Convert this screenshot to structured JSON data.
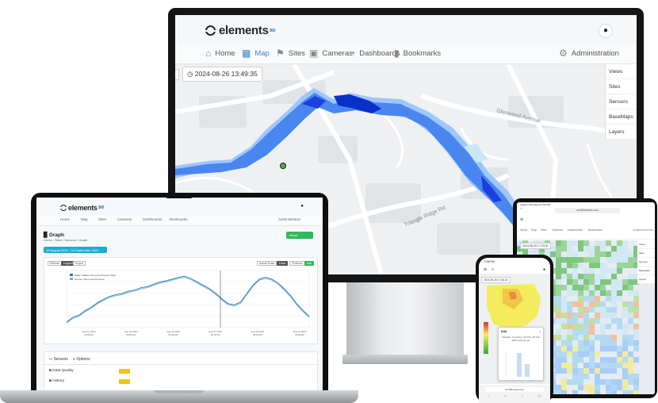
{
  "brand": {
    "name": "elements",
    "suffix": "360",
    "accent": "#3b82c4"
  },
  "monitor": {
    "nav": [
      {
        "label": "Home",
        "icon": "home-icon"
      },
      {
        "label": "Map",
        "icon": "map-icon",
        "active": true
      },
      {
        "label": "Sites",
        "icon": "flag-icon"
      },
      {
        "label": "Cameras",
        "icon": "camera-icon"
      },
      {
        "label": "Dashboards",
        "icon": "gauge-icon"
      },
      {
        "label": "Bookmarks",
        "icon": "bookmark-icon"
      }
    ],
    "admin_label": "Administration",
    "timestamp": "2024-08-26 13:49:35",
    "map_panel": [
      "Views",
      "Sites",
      "Sensors",
      "BaseMaps",
      "Layers"
    ],
    "map_labels": [
      "Glenwood Avenue",
      "Triangle Ridge Rd"
    ]
  },
  "laptop": {
    "nav": [
      "Home",
      "Map",
      "Sites",
      "Cameras",
      "Dashboards",
      "Bookmarks"
    ],
    "admin_label": "Administration",
    "page_title": "Graph",
    "breadcrumb": "Home / Sites / Sensors / Graph",
    "action_button": "Reset",
    "date_range": "19 August 2024 - 02 September 2024",
    "graph_buttons": {
      "left": [
        "Refresh",
        "Legend",
        "Export"
      ],
      "right": [
        "Actual Scale",
        "Lines",
        "Features",
        "Add"
      ]
    },
    "legend": [
      "Wells / Water Line Level Pressure Raw",
      "Sensor / Net Level Pressure"
    ],
    "x_ticks": [
      "Aug 21 2024\n00:00:00",
      "Aug 23 2024\n00:00:00",
      "Aug 25 2024\n00:00:00",
      "Aug 27 2024\n00:00:00",
      "Aug 29 2024\n00:00:00",
      "Aug 31 2024\n00:00:00"
    ],
    "tabs": [
      "Sensors",
      "Options"
    ],
    "rows": [
      "Data Quality",
      "History"
    ]
  },
  "tablet": {
    "status": "August Thursday at 2:50 PM",
    "url": "cm360meets.com",
    "nav": [
      "Home",
      "Map",
      "Sites",
      "Cameras",
      "Dashboards",
      "Bookmarks"
    ],
    "admin_label": "ADMINISTRATION",
    "timestamp": "2024-08-25 17:15:00",
    "panel": [
      "Views",
      "Sites",
      "Sensors",
      "BaseMaps",
      "Layers"
    ]
  },
  "phone": {
    "status_time": "2:58 PM",
    "timestamp": "2024-08-25 17:06:23",
    "popup_title": "Info",
    "popup_text": "Rainfall - Sunshine (19:701, 09:742 2024 frames) per",
    "url": "cm360meets.com"
  },
  "chart_data": {
    "type": "line",
    "title": "",
    "xlabel": "",
    "ylabel": "",
    "ylim": [
      0,
      100
    ],
    "series": [
      {
        "name": "Wells / Water Line Level Pressure Raw",
        "values": [
          10,
          18,
          22,
          30,
          36,
          44,
          50,
          55,
          58,
          60,
          64,
          66,
          70,
          72,
          76,
          80,
          82,
          85,
          88,
          90,
          86,
          80,
          74,
          68,
          60,
          50,
          42,
          40,
          45,
          60,
          75,
          85,
          88,
          85,
          78,
          68,
          56,
          42,
          30,
          20
        ]
      },
      {
        "name": "Sensor / Net Level Pressure",
        "values": [
          8,
          16,
          20,
          28,
          34,
          42,
          48,
          53,
          56,
          58,
          62,
          64,
          68,
          70,
          74,
          78,
          80,
          83,
          86,
          88,
          84,
          78,
          72,
          66,
          58,
          48,
          40,
          38,
          43,
          58,
          73,
          83,
          86,
          83,
          76,
          66,
          54,
          40,
          28,
          18
        ]
      }
    ]
  }
}
